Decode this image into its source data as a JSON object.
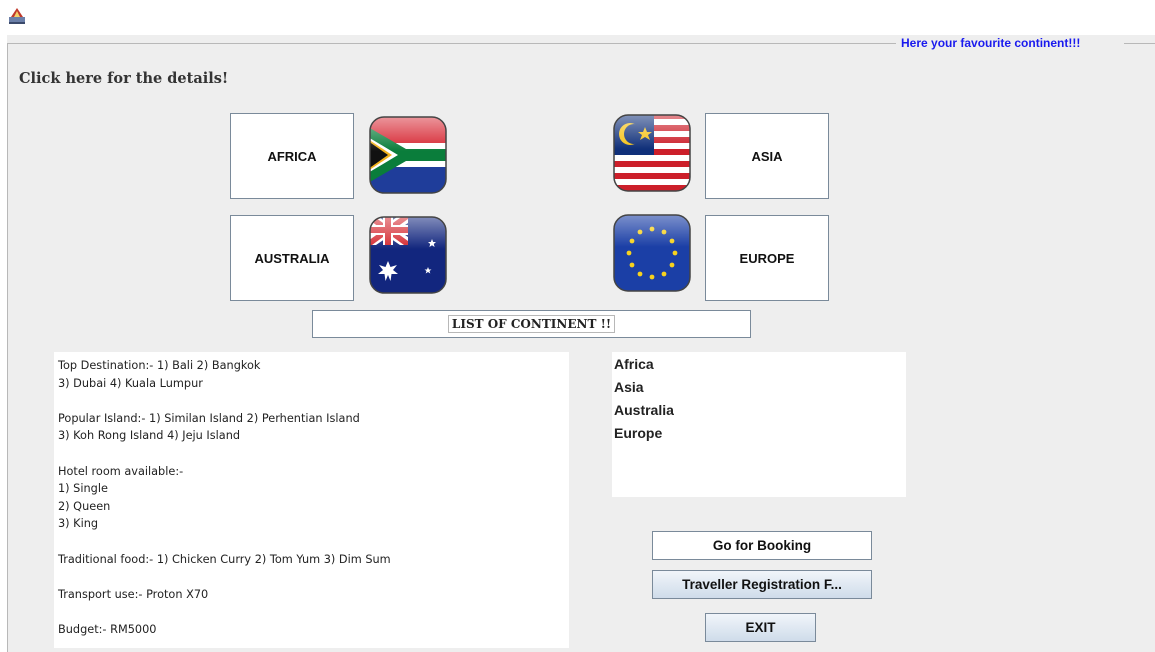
{
  "window": {
    "icon": "java-app-icon"
  },
  "panel": {
    "border_title": "Here your favourite continent!!!"
  },
  "heading": "Click here for the details!",
  "continent_buttons": {
    "africa": "AFRICA",
    "asia": "ASIA",
    "australia": "AUSTRALIA",
    "europe": "EUROPE"
  },
  "flags": [
    "south-africa-flag-icon",
    "malaysia-flag-icon",
    "australia-flag-icon",
    "european-union-flag-icon"
  ],
  "list_title": "LIST OF CONTINENT !!",
  "details": [
    "Top Destination:- 1) Bali 2) Bangkok",
    "3) Dubai 4) Kuala Lumpur",
    "",
    "Popular Island:- 1) Similan Island 2) Perhentian Island",
    "3) Koh Rong Island 4) Jeju Island",
    "",
    "Hotel room available:-",
    "1) Single",
    "2) Queen",
    "3) King",
    "",
    "Traditional food:- 1) Chicken Curry 2) Tom Yum 3) Dim Sum",
    "",
    "Transport use:- Proton X70",
    "",
    "Budget:- RM5000"
  ],
  "continent_list": [
    "Africa",
    "Asia",
    "Australia",
    "Europe"
  ],
  "actions": {
    "booking": "Go for Booking",
    "registration": "Traveller Registration F...",
    "exit": "EXIT"
  },
  "colors": {
    "border_title": "#1a1aee",
    "panel_bg": "#eeeeee",
    "button_border": "#7a8a9a"
  }
}
